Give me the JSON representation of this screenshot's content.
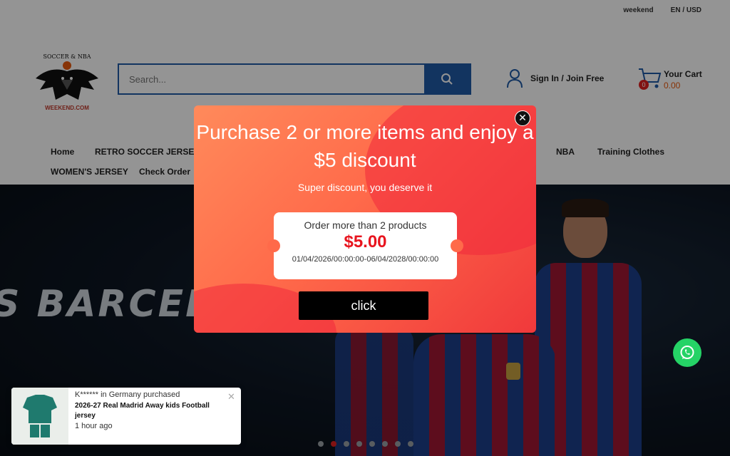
{
  "topbar": {
    "brand_link": "weekend",
    "locale": "EN / USD"
  },
  "logo": {
    "top_text": "SOCCER & NBA",
    "bottom_text": "WEEKEND.COM"
  },
  "search": {
    "placeholder": "Search..."
  },
  "account": {
    "signin_label": "Sign In / Join Free"
  },
  "cart": {
    "label": "Your Cart",
    "count": "0",
    "amount": "0.00"
  },
  "nav": {
    "home": "Home",
    "retro": "RETRO SOCCER JERSEY",
    "nba": "NBA",
    "training": "Training Clothes",
    "womens": "WOMEN'S JERSEY",
    "check_order": "Check Order"
  },
  "hero": {
    "banner_text": "S BARCELO",
    "active_slide": 2,
    "slide_count": 8
  },
  "popup": {
    "title": "Purchase 2 or more items and enjoy a $5 discount",
    "subtitle": "Super discount, you deserve it",
    "coupon_condition": "Order more than 2 products",
    "coupon_value": "$5.00",
    "coupon_validity": "01/04/2026/00:00:00-06/04/2028/00:00:00",
    "button_label": "click",
    "close_label": "✕"
  },
  "toast": {
    "buyer": "K****** in Germany purchased",
    "product": "2026-27 Real Madrid Away kids Football jersey",
    "time": "1 hour ago",
    "close_label": "✕"
  },
  "colors": {
    "brand_blue": "#1f5ba6",
    "popup_gradient_start": "#ff8a5b",
    "popup_gradient_end": "#f0393b",
    "price_red": "#e8141e",
    "whatsapp_green": "#25d366"
  }
}
